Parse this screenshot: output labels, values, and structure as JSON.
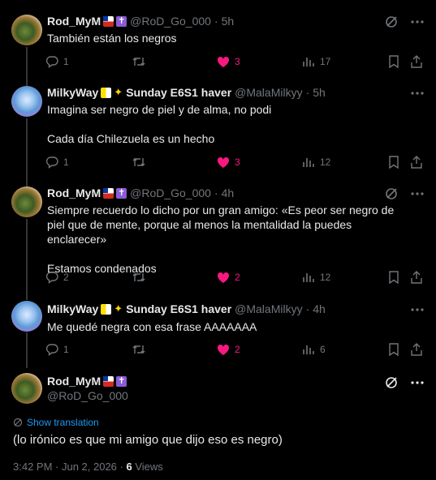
{
  "tweets": [
    {
      "name": "Rod_MyM",
      "handle": "@RoD_Go_000",
      "time": "5h",
      "lines": [
        "También están los negros"
      ],
      "replies": "1",
      "retweets": "",
      "likes": "3",
      "views": "17"
    },
    {
      "name": "MilkyWay",
      "name_suffix": "Sunday E6S1 haver",
      "handle": "@MalaMilkyy",
      "time": "5h",
      "lines": [
        "Imagina ser negro de piel y de alma, no podi",
        "",
        "Cada día Chilezuela es un hecho"
      ],
      "replies": "1",
      "retweets": "",
      "likes": "3",
      "views": "12"
    },
    {
      "name": "Rod_MyM",
      "handle": "@RoD_Go_000",
      "time": "4h",
      "lines": [
        "Siempre recuerdo lo dicho por un gran amigo: «Es peor ser negro de piel que de mente, porque al menos la mentalidad la puedes enclarecer»",
        "",
        "Estamos condenados"
      ],
      "replies": "2",
      "retweets": "",
      "likes": "2",
      "views": "12"
    },
    {
      "name": "MilkyWay",
      "name_suffix": "Sunday E6S1 haver",
      "handle": "@MalaMilkyy",
      "time": "4h",
      "lines": [
        "Me quedé negra con esa frase AAAAAAA"
      ],
      "replies": "1",
      "retweets": "",
      "likes": "2",
      "views": "6"
    }
  ],
  "main": {
    "name": "Rod_MyM",
    "handle": "@RoD_Go_000",
    "translate_label": "Show translation",
    "text": "(lo irónico es que mi amigo que dijo eso es negro)",
    "timestamp": "3:42 PM · Jun 2, 2026 · ",
    "views_count": "6",
    "views_label": " Views"
  },
  "colors": {
    "background": "#000000",
    "text": "#e7e9ea",
    "muted": "#71767b",
    "like": "#f91880",
    "link": "#1d9bf0"
  }
}
